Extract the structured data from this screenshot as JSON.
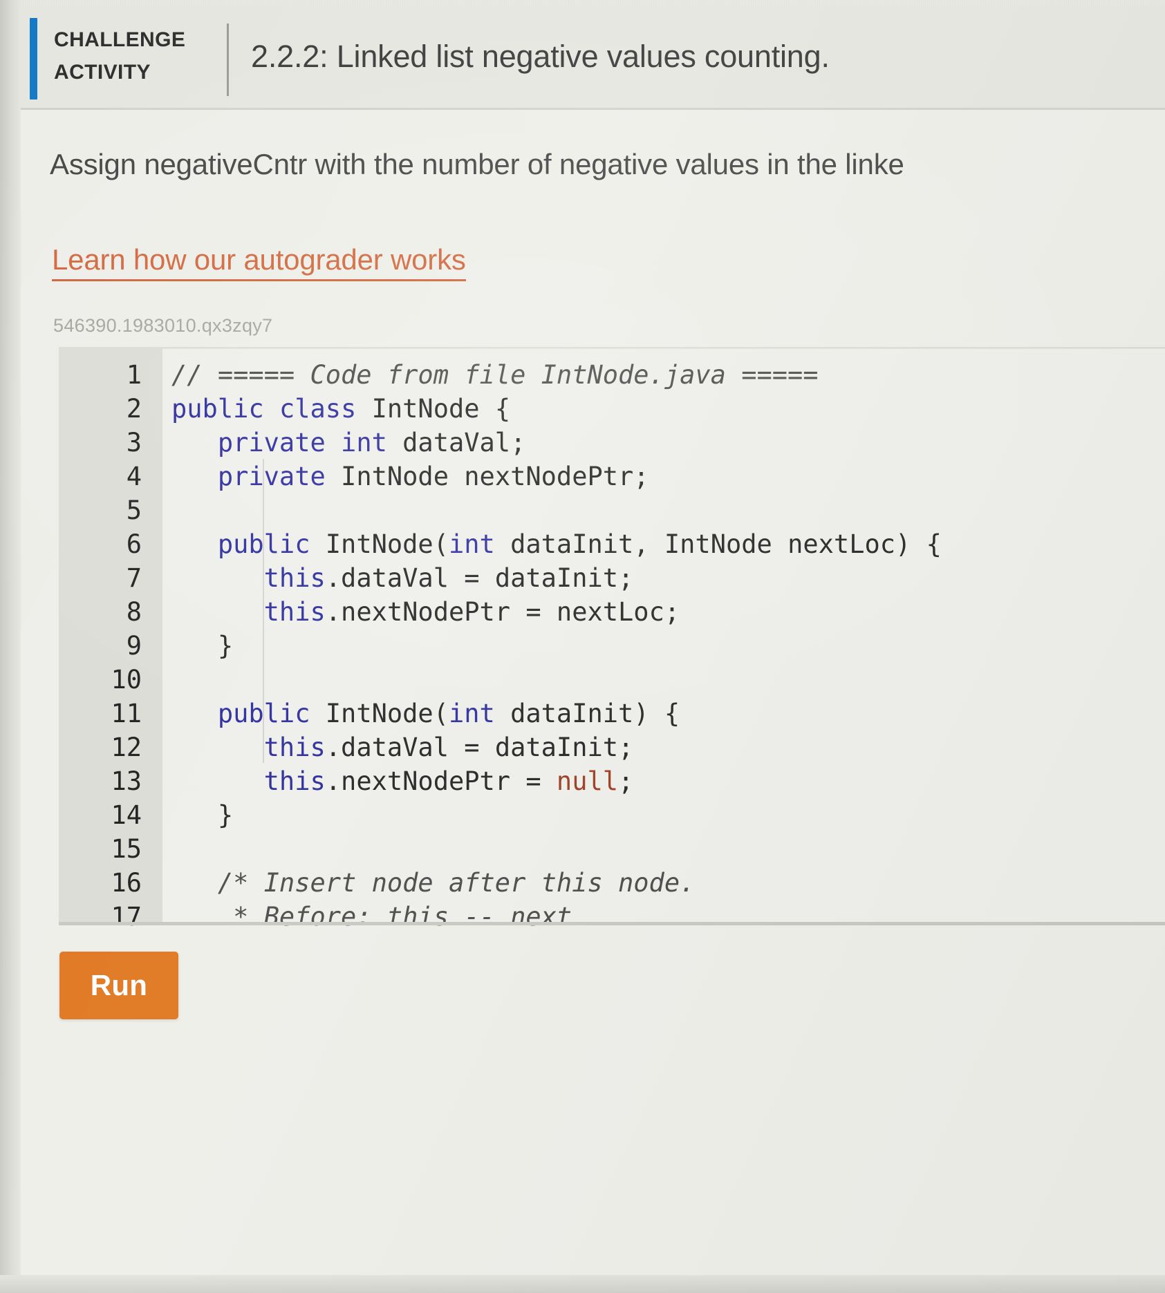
{
  "header": {
    "kicker_line1": "CHALLENGE",
    "kicker_line2": "ACTIVITY",
    "title": "2.2.2: Linked list negative values counting.",
    "accent_color": "#1579c6"
  },
  "main": {
    "prompt": "Assign negativeCntr with the number of negative values in the linke",
    "autograder_link": "Learn how our autograder works",
    "activity_id": "546390.1983010.qx3zqy7",
    "link_color": "#d2673c"
  },
  "editor": {
    "language": "java",
    "lines": [
      {
        "no": "1",
        "code": "// ===== Code from file IntNode.java ====="
      },
      {
        "no": "2",
        "code": "public class IntNode {"
      },
      {
        "no": "3",
        "code": "   private int dataVal;"
      },
      {
        "no": "4",
        "code": "   private IntNode nextNodePtr;"
      },
      {
        "no": "5",
        "code": ""
      },
      {
        "no": "6",
        "code": "   public IntNode(int dataInit, IntNode nextLoc) {"
      },
      {
        "no": "7",
        "code": "      this.dataVal = dataInit;"
      },
      {
        "no": "8",
        "code": "      this.nextNodePtr = nextLoc;"
      },
      {
        "no": "9",
        "code": "   }"
      },
      {
        "no": "10",
        "code": ""
      },
      {
        "no": "11",
        "code": "   public IntNode(int dataInit) {"
      },
      {
        "no": "12",
        "code": "      this.dataVal = dataInit;"
      },
      {
        "no": "13",
        "code": "      this.nextNodePtr = null;"
      },
      {
        "no": "14",
        "code": "   }"
      },
      {
        "no": "15",
        "code": ""
      },
      {
        "no": "16",
        "code": "   /* Insert node after this node."
      },
      {
        "no": "17",
        "code": "    * Before: this -- next"
      }
    ],
    "keyword_color": "#2a2a9c",
    "comment_color": "#4a4a4a",
    "literal_color": "#9c3b20"
  },
  "toolbar": {
    "run_label": "Run",
    "run_color": "#e0761f"
  }
}
